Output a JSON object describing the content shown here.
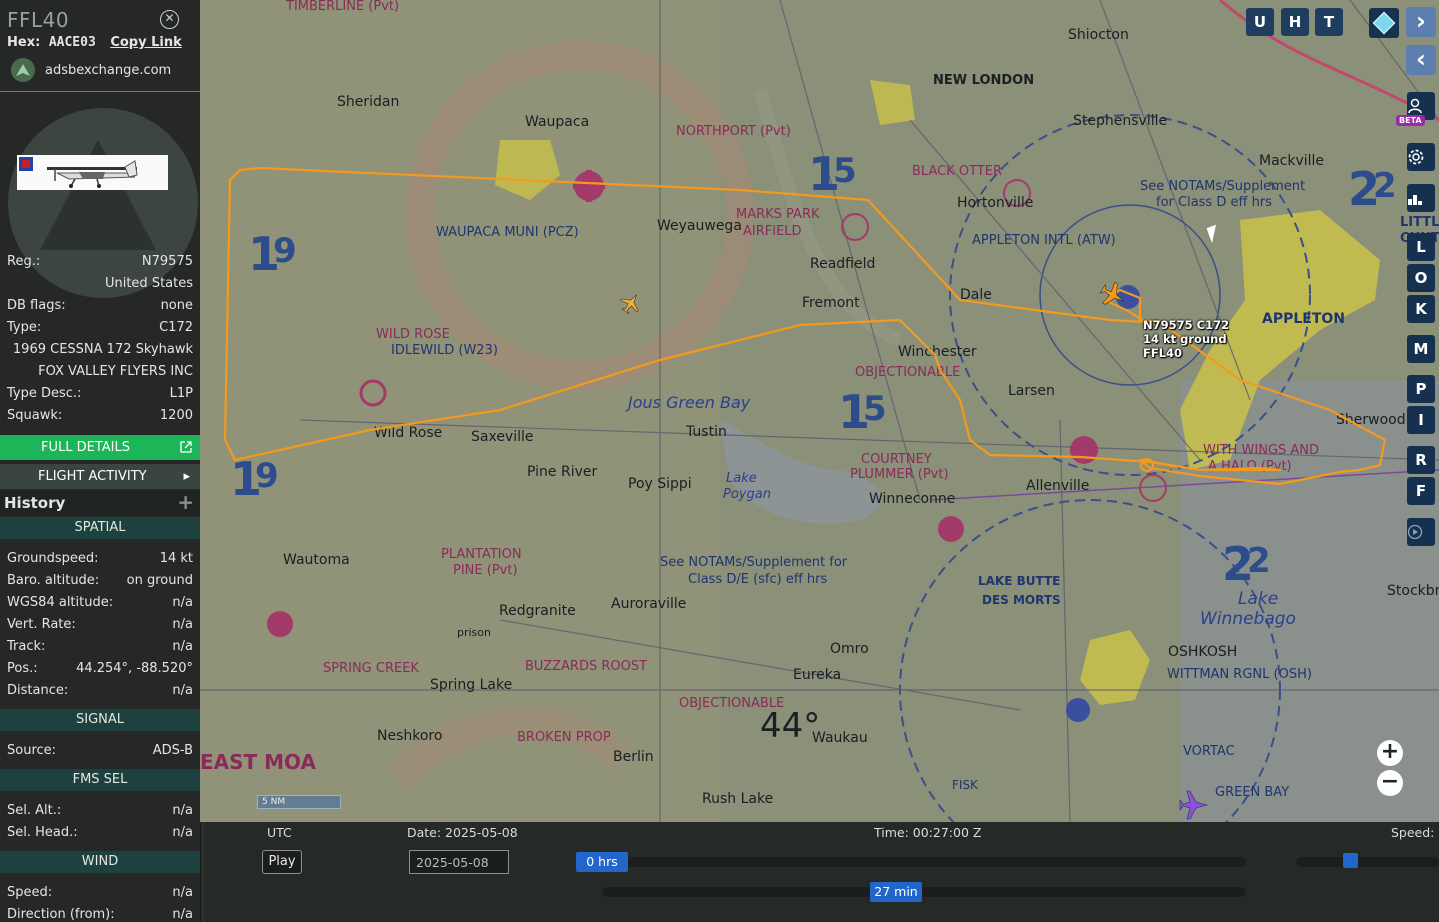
{
  "panel": {
    "callsign": "FFL40",
    "hex_label": "Hex:",
    "hex": "AACE03",
    "copy_link": "Copy Link",
    "source_site": "adsbexchange.com",
    "reg_label": "Reg.:",
    "reg": "N79575",
    "country": "United States",
    "db_flags_label": "DB flags:",
    "db_flags": "none",
    "type_label": "Type:",
    "type": "C172",
    "model": "1969 CESSNA 172 Skyhawk",
    "owner": "FOX VALLEY FLYERS INC",
    "type_desc_label": "Type Desc.:",
    "type_desc": "L1P",
    "squawk_label": "Squawk:",
    "squawk": "1200",
    "full_details": "FULL DETAILS",
    "flight_activity": "FLIGHT ACTIVITY",
    "history": "History",
    "spatial": "SPATIAL",
    "groundspeed_label": "Groundspeed:",
    "groundspeed": "14 kt",
    "baro_label": "Baro. altitude:",
    "baro": "on ground",
    "wgs_label": "WGS84 altitude:",
    "wgs": "n/a",
    "vert_label": "Vert. Rate:",
    "vert": "n/a",
    "track_label": "Track:",
    "track": "n/a",
    "pos_label": "Pos.:",
    "pos": "44.254°, -88.520°",
    "distance_label": "Distance:",
    "distance": "n/a",
    "signal": "SIGNAL",
    "source_label": "Source:",
    "source": "ADS-B",
    "fms": "FMS SEL",
    "sel_alt_label": "Sel. Alt.:",
    "sel_alt": "n/a",
    "sel_head_label": "Sel. Head.:",
    "sel_head": "n/a",
    "wind": "WIND",
    "wind_speed_label": "Speed:",
    "wind_speed": "n/a",
    "wind_dir_label": "Direction (from):",
    "wind_dir": "n/a"
  },
  "map": {
    "buttons": [
      "U",
      "H",
      "T"
    ],
    "side_buttons": [
      "L",
      "O",
      "K",
      "M",
      "P",
      "I",
      "R",
      "F"
    ],
    "beta": "BETA",
    "scale": "5 NM",
    "aircraft_label": [
      "N79575 C172",
      "14 kt ground",
      "FFL40"
    ],
    "labels": {
      "shiocton": "Shiocton",
      "new_london": "NEW LONDON",
      "stephensville": "Stephensville",
      "mackville": "Mackville",
      "sheridan": "Sheridan",
      "waupaca": "Waupaca",
      "northport": "NORTHPORT (Pvt)",
      "black_otter": "BLACK OTTER",
      "hortonville": "Hortonville",
      "weyauwega": "Weyauwega",
      "marks_park": "MARKS PARK",
      "airfield": "AIRFIELD",
      "readfield": "Readfield",
      "fremont": "Fremont",
      "dale": "Dale",
      "appleton_intl": "APPLETON INTL (ATW)",
      "appleton": "APPLETON",
      "waupaca_muni": "WAUPACA MUNI (PCZ)",
      "wild_rose_idlewild": "WILD ROSE",
      "idlewild": "IDLEWILD (W23)",
      "winchester": "Winchester",
      "objectionable": "OBJECTIONABLE",
      "larsen": "Larsen",
      "wild_rose": "Wild Rose",
      "saxeville": "Saxeville",
      "tustin": "Tustin",
      "pine_river": "Pine River",
      "poy_sippi": "Poy Sippi",
      "lake_poygan": "Lake",
      "lake_poygan2": "Poygan",
      "winneconne": "Winneconne",
      "courtney": "COURTNEY",
      "plummer": "PLUMMER (Pvt)",
      "allenville": "Allenville",
      "with_wings": "WITH WINGS AND",
      "a_halo": "A HALO (Pvt)",
      "sherwood": "Sherwood",
      "wautoma": "Wautoma",
      "plantation": "PLANTATION",
      "pine_pvt": "PINE (Pvt)",
      "auroraville": "Auroraville",
      "redgranite": "Redgranite",
      "prison": "prison",
      "spring_creek": "SPRING CREEK",
      "spring_lake": "Spring Lake",
      "buzzards": "BUZZARDS ROOST",
      "omro": "Omro",
      "eureka": "Eureka",
      "lake_butte": "LAKE BUTTE",
      "des_morts": "DES MORTS",
      "oshkosh": "OSHKOSH",
      "wittman": "WITTMAN RGNL (OSH)",
      "lake_winnebago": "Lake",
      "winnebago": "Winnebago",
      "neshkoro": "Neshkoro",
      "broken_prop": "BROKEN PROP",
      "berlin": "Berlin",
      "waukau": "Waukau",
      "rush_lake": "Rush Lake",
      "east_moa": "EAST MOA",
      "fisk": "FISK",
      "green_bay": "GREEN BAY",
      "vortac": "VORTAC",
      "stockbridge": "Stockbrid",
      "little_chute": "LITTLE",
      "chute2": "CHUTE",
      "lat44": "44°",
      "notams1": "See NOTAMs/Supplement",
      "notams2": "for Class D eff hrs",
      "notams3": "See NOTAMs/Supplement for",
      "notams4": "Class D/E (sfc) eff hrs",
      "timberline": "TIMBERLINE (Pvt)",
      "green_bay_sect": "Jous Green Bay"
    }
  },
  "timeline": {
    "utc": "UTC",
    "date_label": "Date: 2025-05-08",
    "time_label": "Time: 00:27:00 Z",
    "speed_label": "Speed:",
    "play": "Play",
    "date_value": "2025-05-08",
    "hours_thumb": "0 hrs",
    "min_thumb": "27 min"
  },
  "colors": {
    "track": "#f39a1e",
    "map_base": "#8e927a",
    "panel_bg": "#252826",
    "section_bg": "#1d413e",
    "accent_green": "#1db55a",
    "slider_blue": "#2266cc"
  }
}
